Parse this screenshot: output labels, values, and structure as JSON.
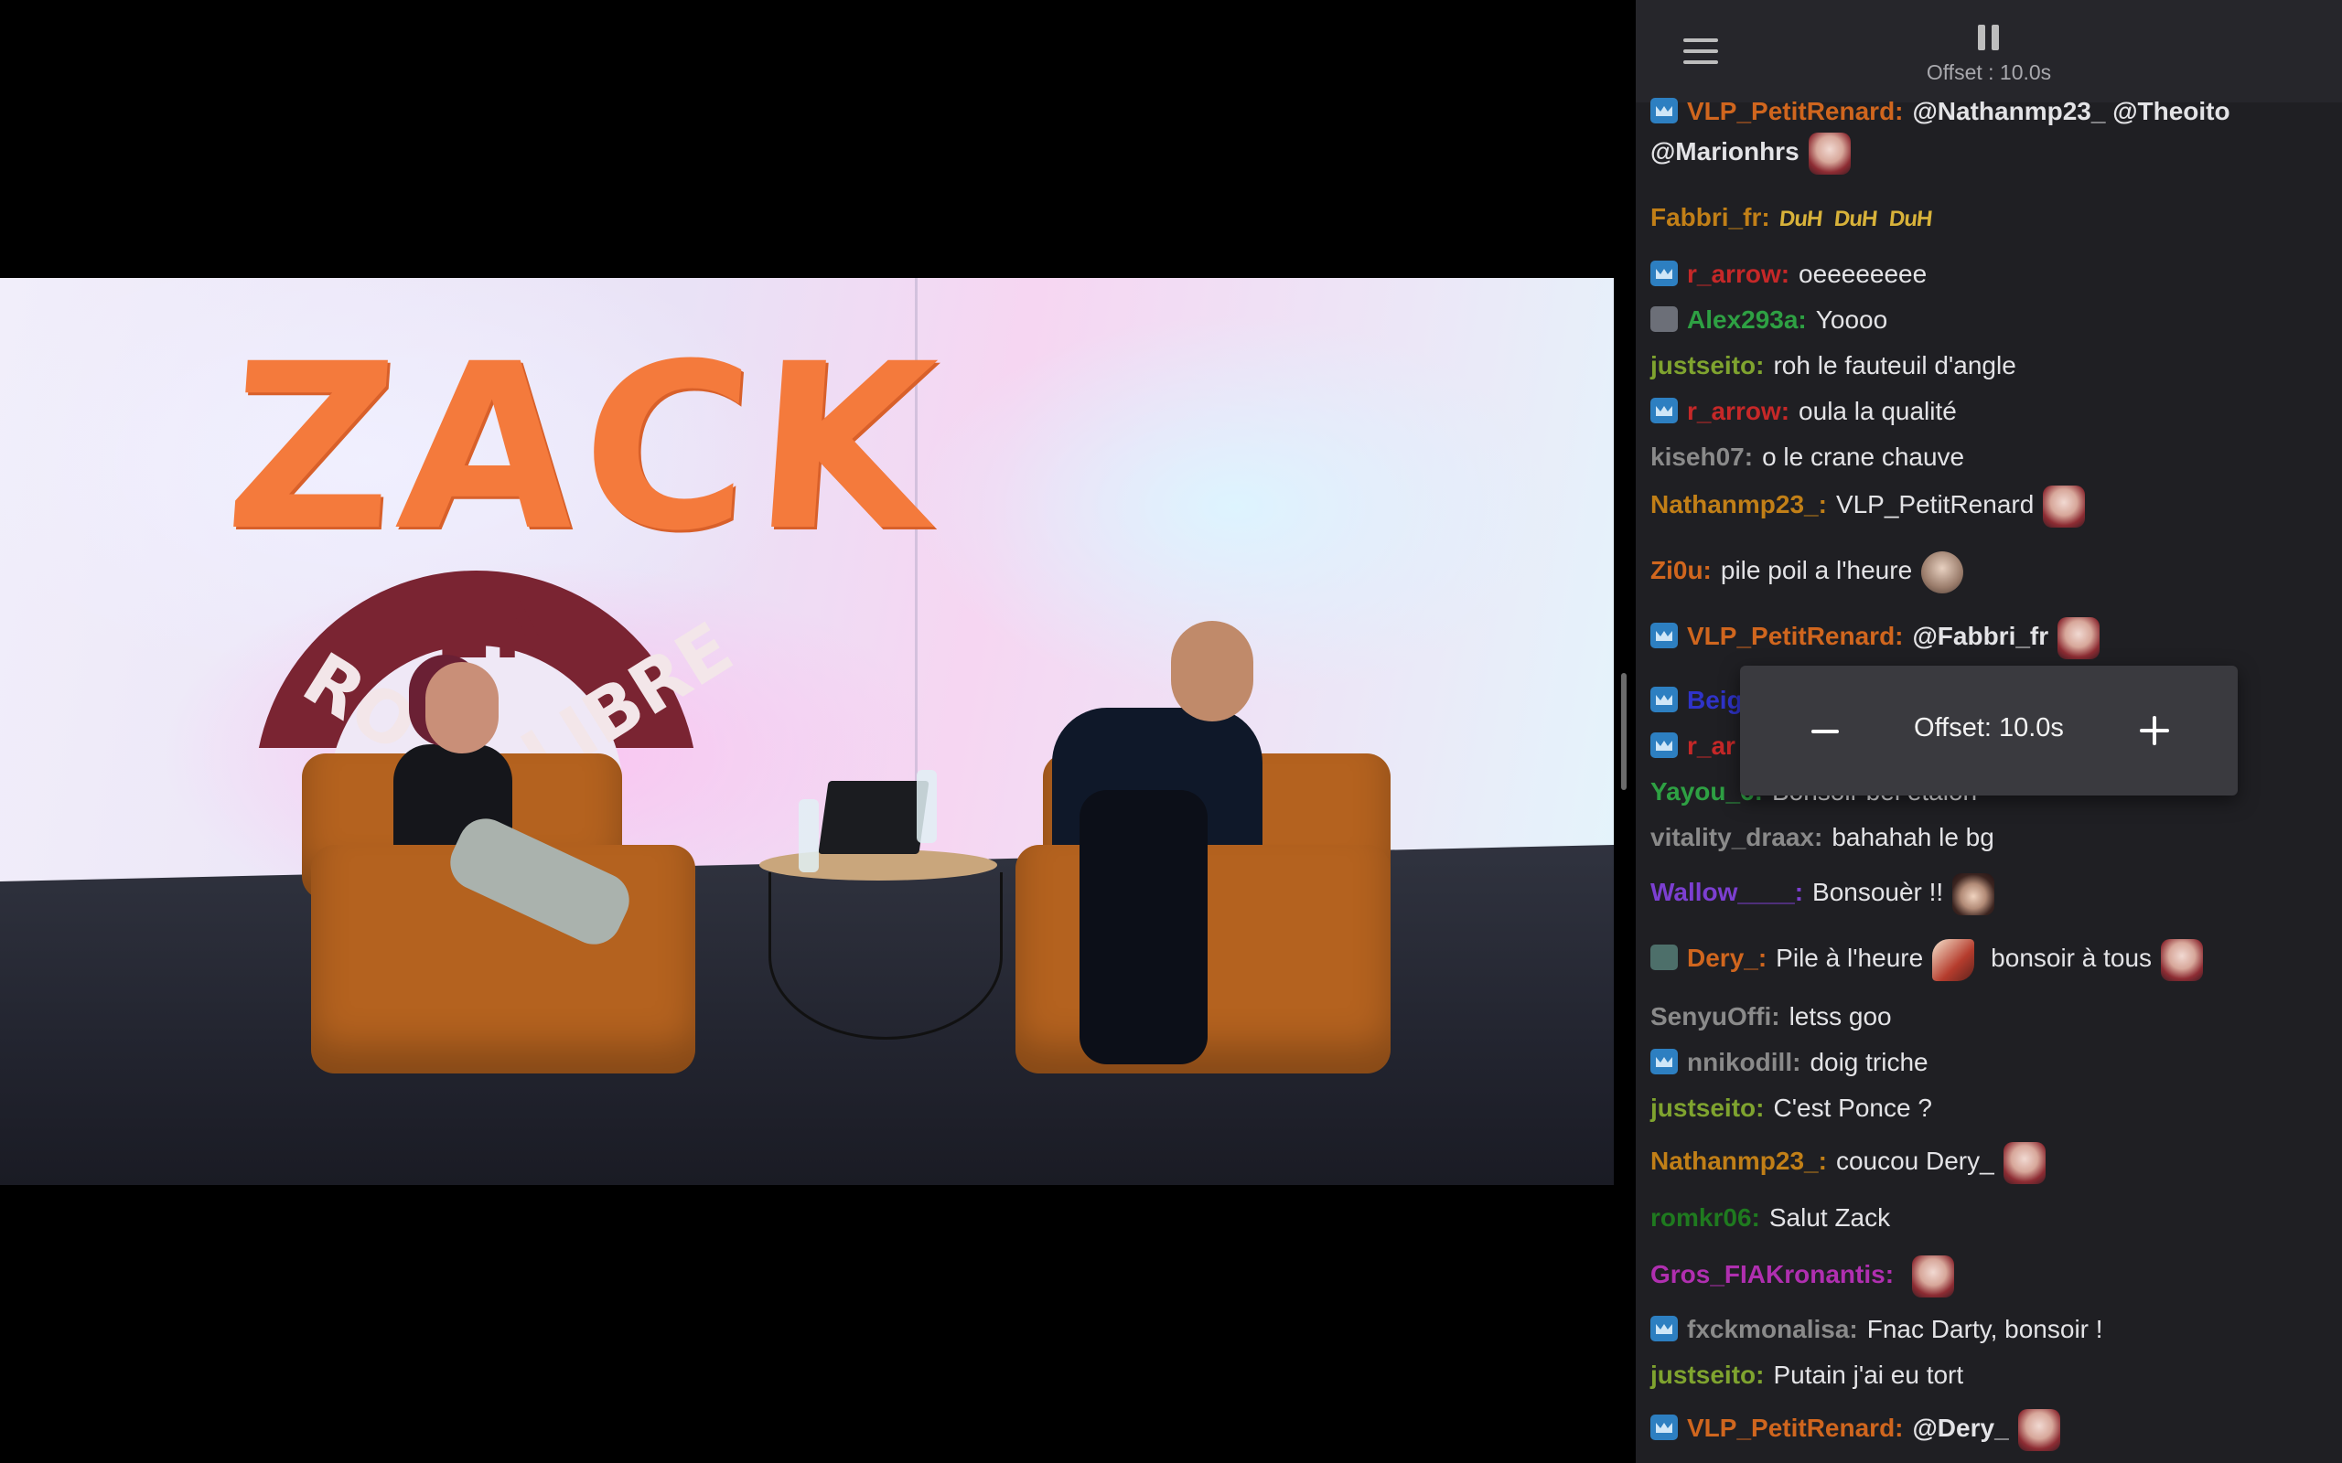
{
  "player": {
    "offset_text": "Offset : 10.0s"
  },
  "popup": {
    "offset_text": "Offset: 10.0s"
  },
  "video": {
    "logo_main": "ZACK",
    "logo_en": "EN",
    "logo_ro": "RO",
    "logo_libre": "LIBRE"
  },
  "chat": {
    "messages": [
      {
        "user": "VLP_PetitRenard:",
        "text": "@Nathanmp23_ @Theoito",
        "text2": "@Marionhrs",
        "color": "#d0661e"
      },
      {
        "user": "Fabbri_fr:",
        "text": "",
        "duh": [
          "DuH",
          "DuH",
          "DuH"
        ],
        "color": "#c17f17"
      },
      {
        "user": "r_arrow:",
        "text": "oeeeeeeee",
        "color": "#c62828"
      },
      {
        "user": "Alex293a:",
        "text": "Yoooo",
        "color": "#2ea043"
      },
      {
        "user": "justseito:",
        "text": "roh le fauteuil d'angle",
        "color": "#7fa32f"
      },
      {
        "user": "r_arrow:",
        "text": "oula la qualité",
        "color": "#c62828"
      },
      {
        "user": "kiseh07:",
        "text": "o le crane chauve",
        "color": "#8a8a8a"
      },
      {
        "user": "Nathanmp23_:",
        "text": "VLP_PetitRenard",
        "color": "#c17f17"
      },
      {
        "user": "Zi0u:",
        "text": "pile poil a l'heure",
        "color": "#d0661e"
      },
      {
        "user": "VLP_PetitRenard:",
        "text": "@Fabbri_fr",
        "color": "#d0661e"
      },
      {
        "user": "Beig",
        "text": "",
        "color": "#2f33c9"
      },
      {
        "user": "r_ar",
        "text": "",
        "color": "#c62828"
      },
      {
        "user": "Yayou_6:",
        "text": "Bonsoir bel etalon",
        "color": "#2ea043"
      },
      {
        "user": "vitality_draax:",
        "text": "bahahah le bg",
        "color": "#8a8a8a"
      },
      {
        "user": "Wallow____:",
        "text": "Bonsouèr !!",
        "color": "#7c3fd1"
      },
      {
        "user": "Dery_:",
        "text": "Pile à l'heure",
        "text2": "bonsoir à tous",
        "color": "#d0661e"
      },
      {
        "user": "SenyuOffi:",
        "text": "letss goo",
        "color": "#8a8a8a"
      },
      {
        "user": "nnikodill:",
        "text": "doig triche",
        "color": "#8a8a8a"
      },
      {
        "user": "justseito:",
        "text": "C'est Ponce ?",
        "color": "#7fa32f"
      },
      {
        "user": "Nathanmp23_:",
        "text": "coucou Dery_",
        "color": "#c17f17"
      },
      {
        "user": "romkr06:",
        "text": "Salut Zack",
        "color": "#1f7a1f"
      },
      {
        "user": "Gros_FIAKronantis:",
        "text": "",
        "color": "#b02fb0"
      },
      {
        "user": "fxckmonalisa:",
        "text": "Fnac Darty, bonsoir !",
        "color": "#8a8a8a"
      },
      {
        "user": "justseito:",
        "text": "Putain j'ai eu tort",
        "color": "#7fa32f"
      },
      {
        "user": "VLP_PetitRenard:",
        "text": "@Dery_",
        "color": "#d0661e"
      }
    ]
  },
  "icons": {
    "menu": "hamburger-menu-icon",
    "pause": "pause-icon",
    "minus": "minus-icon",
    "plus": "plus-icon",
    "badge": "crown-badge-icon"
  }
}
